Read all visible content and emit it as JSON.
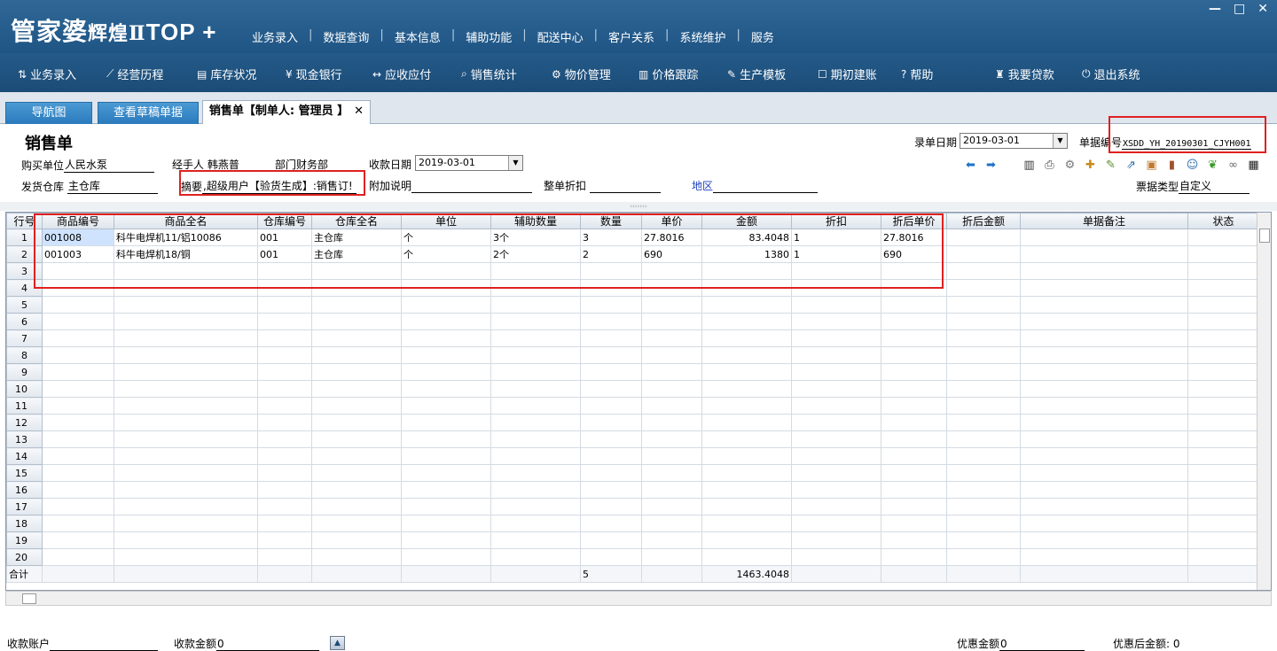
{
  "app": {
    "logo_main": "管家婆",
    "logo_sub": "辉煌Ⅱ",
    "logo_top": "TOP +",
    "top_menu": [
      "业务录入",
      "数据查询",
      "基本信息",
      "辅助功能",
      "配送中心",
      "客户关系",
      "系统维护",
      "服务"
    ],
    "window_controls": [
      "—",
      "□",
      "✕"
    ]
  },
  "toolbar": {
    "items": [
      {
        "icon": "link-icon",
        "glyph": "⇅",
        "label": "业务录入"
      },
      {
        "icon": "chart-line-icon",
        "glyph": "⟋",
        "label": "经营历程"
      },
      {
        "icon": "document-icon",
        "glyph": "▤",
        "label": "库存状况"
      },
      {
        "icon": "yen-icon",
        "glyph": "¥",
        "label": "现金银行"
      },
      {
        "icon": "arrows-icon",
        "glyph": "↔",
        "label": "应收应付"
      },
      {
        "icon": "search-icon",
        "glyph": "⌕",
        "label": "销售统计"
      },
      {
        "icon": "gear-icon",
        "glyph": "⚙",
        "label": "物价管理"
      },
      {
        "icon": "bar-chart-icon",
        "glyph": "▥",
        "label": "价格跟踪"
      },
      {
        "icon": "wrench-icon",
        "glyph": "✎",
        "label": "生产模板"
      },
      {
        "icon": "edit-icon",
        "glyph": "☐",
        "label": "期初建账"
      },
      {
        "icon": "question-icon",
        "glyph": "?",
        "label": "帮助"
      },
      {
        "icon": "moneybag-icon",
        "glyph": "♜",
        "label": "我要贷款"
      },
      {
        "icon": "power-icon",
        "glyph": "⏻",
        "label": "退出系统"
      }
    ]
  },
  "tabs": [
    {
      "label": "导航图"
    },
    {
      "label": "查看草稿单据"
    },
    {
      "label": "销售单【制单人: 管理员 】",
      "close": "✕"
    }
  ],
  "form": {
    "title": "销售单",
    "buyer_label": "购买单位",
    "buyer_value": "人民水泵",
    "handler_label": "经手人",
    "handler_value": "韩燕普",
    "dept_label": "部门",
    "dept_value": "财务部",
    "pay_date_label": "收款日期",
    "pay_date_value": "2019-03-01",
    "entry_date_label": "录单日期",
    "entry_date_value": "2019-03-01",
    "bill_no_label": "单据编号",
    "bill_no_value": "XSDD_YH_20190301_CJYH001",
    "warehouse_label": "发货仓库",
    "warehouse_value": "主仓库",
    "summary_label": "摘要",
    "summary_value": ",超级用户【验货生成】:销售订!",
    "extra_label": "附加说明",
    "extra_value": "",
    "discount_label": "整单折扣",
    "discount_value": "",
    "region_label": "地区",
    "region_value": "",
    "bill_type_label": "票据类型",
    "bill_type_value": "自定义"
  },
  "action_icons": [
    {
      "name": "back-arrow-icon",
      "glyph": "⬅",
      "color": "#1e73c8"
    },
    {
      "name": "forward-arrow-icon",
      "glyph": "➡",
      "color": "#1e73c8"
    },
    {
      "name": "bar-chart-icon",
      "glyph": "▥",
      "color": "#333333"
    },
    {
      "name": "printer-icon",
      "glyph": "⎙",
      "color": "#444444"
    },
    {
      "name": "gear-icon",
      "glyph": "⚙",
      "color": "#777777"
    },
    {
      "name": "add-document-icon",
      "glyph": "✚",
      "color": "#c88a1a"
    },
    {
      "name": "edit-note-icon",
      "glyph": "✎",
      "color": "#5a8a2a"
    },
    {
      "name": "export-icon",
      "glyph": "⇗",
      "color": "#2a6aa8"
    },
    {
      "name": "package-icon",
      "glyph": "▣",
      "color": "#c07a30"
    },
    {
      "name": "door-icon",
      "glyph": "▮",
      "color": "#a0522d"
    },
    {
      "name": "user-icon",
      "glyph": "☺",
      "color": "#2a6aa8"
    },
    {
      "name": "leaf-icon",
      "glyph": "❦",
      "color": "#3a9a2a"
    },
    {
      "name": "chain-link-icon",
      "glyph": "∞",
      "color": "#666666"
    },
    {
      "name": "qr-code-icon",
      "glyph": "▦",
      "color": "#222222"
    }
  ],
  "grid": {
    "columns": [
      "行号",
      "商品编号",
      "商品全名",
      "仓库编号",
      "仓库全名",
      "单位",
      "辅助数量",
      "数量",
      "单价",
      "金额",
      "折扣",
      "折后单价",
      "折后金额",
      "单据备注",
      "状态"
    ],
    "rows": [
      [
        "1",
        "001008",
        "科牛电焊机11/铝10086",
        "001",
        "主仓库",
        "个",
        "3个",
        "3",
        "27.8016",
        "83.4048",
        "1",
        "27.8016",
        "",
        "",
        ""
      ],
      [
        "2",
        "001003",
        "科牛电焊机18/铜",
        "001",
        "主仓库",
        "个",
        "2个",
        "2",
        "690",
        "1380",
        "1",
        "690",
        "",
        "",
        ""
      ],
      [
        "3",
        "",
        "",
        "",
        "",
        "",
        "",
        "",
        "",
        "",
        "",
        "",
        "",
        "",
        ""
      ],
      [
        "4",
        "",
        "",
        "",
        "",
        "",
        "",
        "",
        "",
        "",
        "",
        "",
        "",
        "",
        ""
      ],
      [
        "5",
        "",
        "",
        "",
        "",
        "",
        "",
        "",
        "",
        "",
        "",
        "",
        "",
        "",
        ""
      ],
      [
        "6",
        "",
        "",
        "",
        "",
        "",
        "",
        "",
        "",
        "",
        "",
        "",
        "",
        "",
        ""
      ],
      [
        "7",
        "",
        "",
        "",
        "",
        "",
        "",
        "",
        "",
        "",
        "",
        "",
        "",
        "",
        ""
      ],
      [
        "8",
        "",
        "",
        "",
        "",
        "",
        "",
        "",
        "",
        "",
        "",
        "",
        "",
        "",
        ""
      ],
      [
        "9",
        "",
        "",
        "",
        "",
        "",
        "",
        "",
        "",
        "",
        "",
        "",
        "",
        "",
        ""
      ],
      [
        "10",
        "",
        "",
        "",
        "",
        "",
        "",
        "",
        "",
        "",
        "",
        "",
        "",
        "",
        ""
      ],
      [
        "11",
        "",
        "",
        "",
        "",
        "",
        "",
        "",
        "",
        "",
        "",
        "",
        "",
        "",
        ""
      ],
      [
        "12",
        "",
        "",
        "",
        "",
        "",
        "",
        "",
        "",
        "",
        "",
        "",
        "",
        "",
        ""
      ],
      [
        "13",
        "",
        "",
        "",
        "",
        "",
        "",
        "",
        "",
        "",
        "",
        "",
        "",
        "",
        ""
      ],
      [
        "14",
        "",
        "",
        "",
        "",
        "",
        "",
        "",
        "",
        "",
        "",
        "",
        "",
        "",
        ""
      ],
      [
        "15",
        "",
        "",
        "",
        "",
        "",
        "",
        "",
        "",
        "",
        "",
        "",
        "",
        "",
        ""
      ],
      [
        "16",
        "",
        "",
        "",
        "",
        "",
        "",
        "",
        "",
        "",
        "",
        "",
        "",
        "",
        ""
      ],
      [
        "17",
        "",
        "",
        "",
        "",
        "",
        "",
        "",
        "",
        "",
        "",
        "",
        "",
        "",
        ""
      ],
      [
        "18",
        "",
        "",
        "",
        "",
        "",
        "",
        "",
        "",
        "",
        "",
        "",
        "",
        "",
        ""
      ],
      [
        "19",
        "",
        "",
        "",
        "",
        "",
        "",
        "",
        "",
        "",
        "",
        "",
        "",
        "",
        ""
      ],
      [
        "20",
        "",
        "",
        "",
        "",
        "",
        "",
        "",
        "",
        "",
        "",
        "",
        "",
        "",
        ""
      ]
    ],
    "total": [
      "合计",
      "",
      "",
      "",
      "",
      "",
      "",
      "5",
      "",
      "1463.4048",
      "",
      "",
      "",
      "",
      ""
    ]
  },
  "footer": {
    "account_label": "收款账户",
    "account_value": "",
    "amount_label": "收款金额",
    "amount_value": "0",
    "discount_amount_label": "优惠金额",
    "discount_amount_value": "0",
    "after_discount_label": "优惠后金额:",
    "after_discount_value": "0"
  },
  "colors": {
    "header_bg": "#2f6797",
    "toolbar_bg": "#245a89",
    "highlight_red": "#e02020",
    "tab_blue": "#2a7abd"
  }
}
